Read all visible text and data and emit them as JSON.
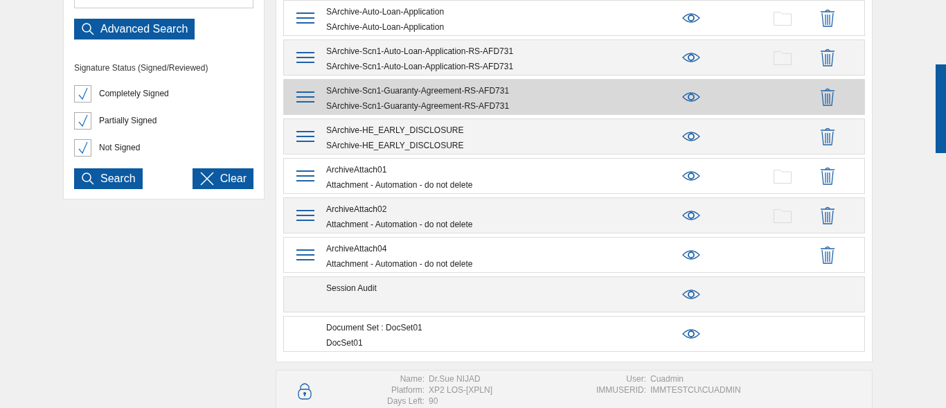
{
  "filter": {
    "advanced_search_button": "Advanced Search",
    "signature_status_label": "Signature Status (Signed/Reviewed)",
    "checkboxes": [
      {
        "label": "Completely Signed",
        "checked": true
      },
      {
        "label": "Partially Signed",
        "checked": true
      },
      {
        "label": "Not Signed",
        "checked": true
      }
    ],
    "search_button": "Search",
    "clear_button": "Clear"
  },
  "documents": [
    {
      "title": "SArchive-Auto-Loan-Application",
      "subtitle": "SArchive-Auto-Loan-Application",
      "has_menu": true,
      "has_folder": true,
      "has_delete": true,
      "selected": false
    },
    {
      "title": "SArchive-Scn1-Auto-Loan-Application-RS-AFD731",
      "subtitle": "SArchive-Scn1-Auto-Loan-Application-RS-AFD731",
      "has_menu": true,
      "has_folder": true,
      "has_delete": true,
      "selected": false
    },
    {
      "title": "SArchive-Scn1-Guaranty-Agreement-RS-AFD731",
      "subtitle": "SArchive-Scn1-Guaranty-Agreement-RS-AFD731",
      "has_menu": true,
      "has_folder": false,
      "has_delete": true,
      "selected": true
    },
    {
      "title": "SArchive-HE_EARLY_DISCLOSURE",
      "subtitle": "SArchive-HE_EARLY_DISCLOSURE",
      "has_menu": true,
      "has_folder": false,
      "has_delete": true,
      "selected": false
    },
    {
      "title": "ArchiveAttach01",
      "subtitle": "Attachment - Automation - do not delete",
      "has_menu": true,
      "has_folder": true,
      "has_delete": true,
      "selected": false
    },
    {
      "title": "ArchiveAttach02",
      "subtitle": "Attachment - Automation - do not delete",
      "has_menu": true,
      "has_folder": true,
      "has_delete": true,
      "selected": false
    },
    {
      "title": "ArchiveAttach04",
      "subtitle": "Attachment - Automation - do not delete",
      "has_menu": true,
      "has_folder": false,
      "has_delete": true,
      "selected": false
    },
    {
      "title": "Session Audit",
      "has_menu": false,
      "has_folder": false,
      "has_delete": false,
      "selected": false
    },
    {
      "title": "Document Set : DocSet01",
      "subtitle": "DocSet01",
      "has_menu": false,
      "has_folder": false,
      "has_delete": false,
      "selected": false
    }
  ],
  "footer": {
    "left": [
      {
        "label": "Name:",
        "value": "Dr.Sue NIJAD"
      },
      {
        "label": "Platform:",
        "value": "XP2 LOS-[XPLN]"
      },
      {
        "label": "Days Left:",
        "value": "90"
      }
    ],
    "right": [
      {
        "label": "User:",
        "value": "Cuadmin"
      },
      {
        "label": "IMMUSERID:",
        "value": "IMMTESTCU\\CUADMIN"
      }
    ]
  }
}
